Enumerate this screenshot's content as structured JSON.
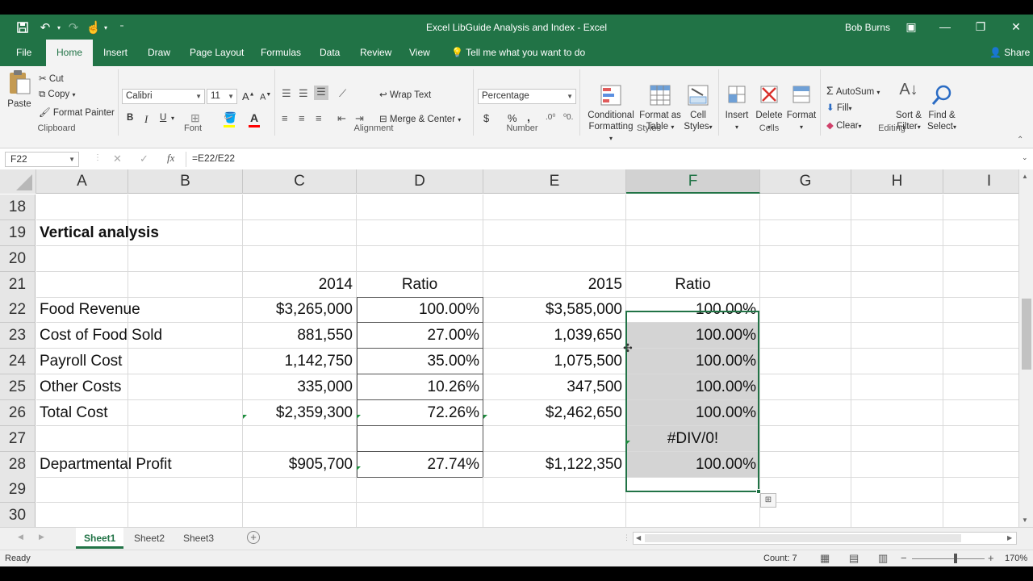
{
  "window": {
    "title": "Excel LibGuide Analysis and Index - Excel",
    "user": "Bob Burns",
    "accent": "#217346"
  },
  "menu": {
    "tabs": [
      "File",
      "Home",
      "Insert",
      "Draw",
      "Page Layout",
      "Formulas",
      "Data",
      "Review",
      "View"
    ],
    "active": "Home",
    "tell_me": "Tell me what you want to do",
    "share": "Share"
  },
  "ribbon": {
    "clipboard": {
      "label": "Clipboard",
      "paste": "Paste",
      "cut": "Cut",
      "copy": "Copy",
      "format_painter": "Format Painter"
    },
    "font": {
      "label": "Font",
      "name": "Calibri",
      "size": "11",
      "bold": "B",
      "italic": "I",
      "underline": "U",
      "grow": "A",
      "shrink": "A"
    },
    "alignment": {
      "label": "Alignment",
      "wrap": "Wrap Text",
      "merge": "Merge & Center"
    },
    "number": {
      "label": "Number",
      "format": "Percentage",
      "currency": "$",
      "percent": "%",
      "comma": ","
    },
    "styles": {
      "label": "Styles",
      "conditional": "Conditional",
      "conditional2": "Formatting",
      "format_table": "Format as",
      "format_table2": "Table",
      "cell_styles": "Cell",
      "cell_styles2": "Styles"
    },
    "cells": {
      "label": "Cells",
      "insert": "Insert",
      "delete": "Delete",
      "format": "Format"
    },
    "editing": {
      "label": "Editing",
      "autosum": "AutoSum",
      "fill": "Fill",
      "clear": "Clear",
      "sort": "Sort &",
      "sort2": "Filter",
      "find": "Find &",
      "find2": "Select"
    }
  },
  "formula_bar": {
    "name_box": "F22",
    "fx": "fx",
    "formula": "=E22/E22"
  },
  "columns": [
    "A",
    "B",
    "C",
    "D",
    "E",
    "F",
    "G",
    "H",
    "I"
  ],
  "selected_column": "F",
  "rows": [
    {
      "n": "18",
      "a": "",
      "c": "",
      "d": "",
      "e": "",
      "f": ""
    },
    {
      "n": "19",
      "a": "Vertical analysis",
      "c": "",
      "d": "",
      "e": "",
      "f": ""
    },
    {
      "n": "20",
      "a": "",
      "c": "",
      "d": "",
      "e": "",
      "f": ""
    },
    {
      "n": "21",
      "a": "",
      "c": "2014",
      "d": "Ratio",
      "e": "2015",
      "f": "Ratio"
    },
    {
      "n": "22",
      "a": "Food Revenue",
      "c": "$3,265,000",
      "d": "100.00%",
      "e": "$3,585,000",
      "f": "100.00%"
    },
    {
      "n": "23",
      "a": "Cost of Food Sold",
      "c": "881,550",
      "d": "27.00%",
      "e": "1,039,650",
      "f": "100.00%"
    },
    {
      "n": "24",
      "a": "Payroll Cost",
      "c": "1,142,750",
      "d": "35.00%",
      "e": "1,075,500",
      "f": "100.00%"
    },
    {
      "n": "25",
      "a": "Other Costs",
      "c": "335,000",
      "d": "10.26%",
      "e": "347,500",
      "f": "100.00%"
    },
    {
      "n": "26",
      "a": "Total Cost",
      "c": "$2,359,300",
      "d": "72.26%",
      "e": "$2,462,650",
      "f": "100.00%"
    },
    {
      "n": "27",
      "a": "",
      "c": "",
      "d": "",
      "e": "",
      "f": "#DIV/0!"
    },
    {
      "n": "28",
      "a": "Departmental Profit",
      "c": "$905,700",
      "d": "27.74%",
      "e": "$1,122,350",
      "f": "100.00%"
    },
    {
      "n": "29",
      "a": "",
      "c": "",
      "d": "",
      "e": "",
      "f": ""
    },
    {
      "n": "30",
      "a": "",
      "c": "",
      "d": "",
      "e": "",
      "f": ""
    }
  ],
  "sheets": [
    "Sheet1",
    "Sheet2",
    "Sheet3"
  ],
  "active_sheet": "Sheet1",
  "status": {
    "ready": "Ready",
    "count": "Count: 7",
    "zoom": "170%"
  }
}
